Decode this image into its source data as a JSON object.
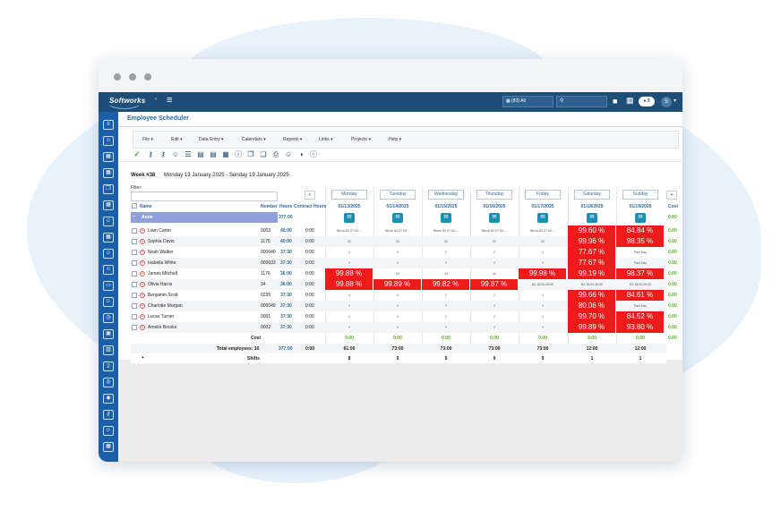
{
  "app": {
    "brand": "Softworks",
    "title": "Employee Scheduler",
    "scope_select": "(83) All",
    "notification_count": "3",
    "user_initial": "S"
  },
  "menu": [
    "File",
    "Edit",
    "Data Entry",
    "Calendars",
    "Reports",
    "Links",
    "Projects",
    "Help"
  ],
  "toolbar_icons": [
    "check-icon",
    "key-icon",
    "key-icon",
    "user-gear-icon",
    "list-icon",
    "document-icon",
    "document-icon",
    "calendar-icon",
    "info-icon",
    "copy-icon",
    "paste-icon",
    "printer-icon",
    "user-icon",
    "chart-icon",
    "info-icon"
  ],
  "week": {
    "number": "Week #38",
    "range": "Monday 13 January 2025 - Sunday 19 January 2025"
  },
  "filter": {
    "label": "Filter:"
  },
  "nav": {
    "prev": "<",
    "next": "+"
  },
  "days": [
    "Monday",
    "Tuesday",
    "Wednesday",
    "Thursday",
    "Friday",
    "Saturday",
    "Sunday"
  ],
  "dates": [
    "01/13/2025",
    "01/14/2025",
    "01/15/2025",
    "01/16/2025",
    "01/17/2025",
    "01/18/2025",
    "01/19/2025"
  ],
  "columns": {
    "name": "Name",
    "number": "Number",
    "hours": "Hours",
    "contract": "Contract Hours",
    "cost": "Cost"
  },
  "group": {
    "name": "Anne",
    "hours": "377:00",
    "cost": "0.00"
  },
  "employees": [
    {
      "name": "Liam Carter",
      "number": "0003",
      "hours": "40:00",
      "contract": "0:00",
      "cells": [
        "Bmon 82 07:00-...",
        "Bmon 82 07:00-...",
        "Bmon 82 07:00-...",
        "Bmon 82 07:00-...",
        "Bmon 82 07:00-...",
        "99.60 %",
        "84.84 %"
      ],
      "cost": "0.00"
    },
    {
      "name": "Sophia Davis",
      "number": "1175",
      "hours": "40:00",
      "contract": "0:00",
      "cells": [
        "02",
        "02",
        "02",
        "02",
        "02",
        "99.96 %",
        "98.35 %"
      ],
      "cost": "0.00"
    },
    {
      "name": "Noah Walker",
      "number": "000040",
      "hours": "37:30",
      "contract": "0:00",
      "cells": [
        "2",
        "2",
        "2",
        "2",
        "2",
        "77.67 %",
        "Paid Day"
      ],
      "cost": "0.00"
    },
    {
      "name": "Isabella White",
      "number": "000033",
      "hours": "37:30",
      "contract": "0:00",
      "cells": [
        "2",
        "2",
        "2",
        "2",
        "2",
        "77.67 %",
        "Paid Day"
      ],
      "cost": "0.00"
    },
    {
      "name": "James Mitchell",
      "number": "1176",
      "hours": "36:00",
      "contract": "0:00",
      "cells": [
        "99.88 %",
        "44",
        "44",
        "44",
        "99.98 %",
        "99.19 %",
        "98.37 %"
      ],
      "cost": "0.00"
    },
    {
      "name": "Olivia Harris",
      "number": "34",
      "hours": "36:00",
      "contract": "0:00",
      "cells": [
        "99.88 %",
        "99.89 %",
        "99.82 %",
        "99.87 %",
        "B2 18:00-06:00",
        "B2 18:00-06:00",
        "B2 18:00-06:00"
      ],
      "cost": "0.00"
    },
    {
      "name": "Benjamin Scott",
      "number": "0235",
      "hours": "37:30",
      "contract": "0:00",
      "cells": [
        "2",
        "2",
        "2",
        "2",
        "2",
        "99.66 %",
        "84.61 %"
      ],
      "cost": "0.00"
    },
    {
      "name": "Charlotte Morgan",
      "number": "000049",
      "hours": "37:30",
      "contract": "0:00",
      "cells": [
        "2",
        "2",
        "2",
        "2",
        "2",
        "80.06 %",
        "Paid Day"
      ],
      "cost": "0.00"
    },
    {
      "name": "Lucas Turner",
      "number": "0001",
      "hours": "37:30",
      "contract": "0:00",
      "cells": [
        "2",
        "2",
        "2",
        "2",
        "2",
        "99.70 %",
        "84.52 %"
      ],
      "cost": "0.00"
    },
    {
      "name": "Amelia Brooks",
      "number": "0002",
      "hours": "37:30",
      "contract": "0:00",
      "cells": [
        "2",
        "2",
        "2",
        "2",
        "2",
        "99.89 %",
        "93.80 %"
      ],
      "cost": "0.00"
    }
  ],
  "summary": {
    "cost_label": "Cost",
    "costs": [
      "0.00",
      "0.00",
      "0.00",
      "0.00",
      "0.00",
      "0.00",
      "0.00"
    ],
    "cost_total": "0.00",
    "total_label": "Total employees: 10",
    "total_hours": "377:00",
    "total_contract": "0:00",
    "day_totals": [
      "61:00",
      "73:00",
      "73:00",
      "73:00",
      "73:00",
      "12:00",
      "12:00"
    ],
    "shifts_label": "Shifts",
    "shifts": [
      "8",
      "9",
      "9",
      "9",
      "9",
      "1",
      "1"
    ]
  }
}
